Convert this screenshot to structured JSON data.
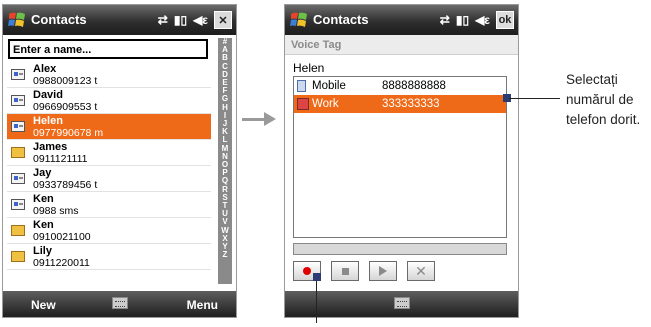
{
  "left_phone": {
    "title": "Contacts",
    "icons": [
      "sync-icon",
      "signal-icon",
      "volume-icon"
    ],
    "close_label": "✕",
    "search": {
      "value": "Enter a name..."
    },
    "alphabet": [
      "#",
      "A",
      "B",
      "C",
      "D",
      "E",
      "F",
      "G",
      "H",
      "I",
      "J",
      "K",
      "L",
      "M",
      "N",
      "O",
      "P",
      "Q",
      "R",
      "S",
      "T",
      "U",
      "V",
      "W",
      "X",
      "Y",
      "Z"
    ],
    "contacts": [
      {
        "name": "Alex",
        "detail": "0988009123  t",
        "icon": "contact-card-icon"
      },
      {
        "name": "David",
        "detail": "0966909553  t",
        "icon": "contact-card-icon"
      },
      {
        "name": "Helen",
        "detail": "0977990678  m",
        "icon": "contact-card-icon",
        "selected": true
      },
      {
        "name": "James",
        "detail": "0911121111",
        "icon": "contact-note-icon"
      },
      {
        "name": "Jay",
        "detail": "0933789456  t",
        "icon": "contact-card-icon"
      },
      {
        "name": "Ken",
        "detail": "0988  sms",
        "icon": "contact-card-icon"
      },
      {
        "name": "Ken",
        "detail": "0910021100",
        "icon": "contact-note-icon"
      },
      {
        "name": "Lily",
        "detail": "0911220011",
        "icon": "contact-note-icon"
      }
    ],
    "softkeys": {
      "left": "New",
      "right": "Menu"
    }
  },
  "right_phone": {
    "title": "Contacts",
    "ok_label": "ok",
    "section": "Voice Tag",
    "contact_name": "Helen",
    "numbers": [
      {
        "label": "Mobile",
        "value": "8888888888",
        "icon": "mobile-phone-icon"
      },
      {
        "label": "Work",
        "value": "333333333",
        "icon": "work-phone-icon",
        "selected": true
      }
    ]
  },
  "callout": {
    "text": "Selectați numărul de telefon dorit."
  },
  "colors": {
    "selection": "#ef6a18",
    "marker": "#2d3b75"
  }
}
